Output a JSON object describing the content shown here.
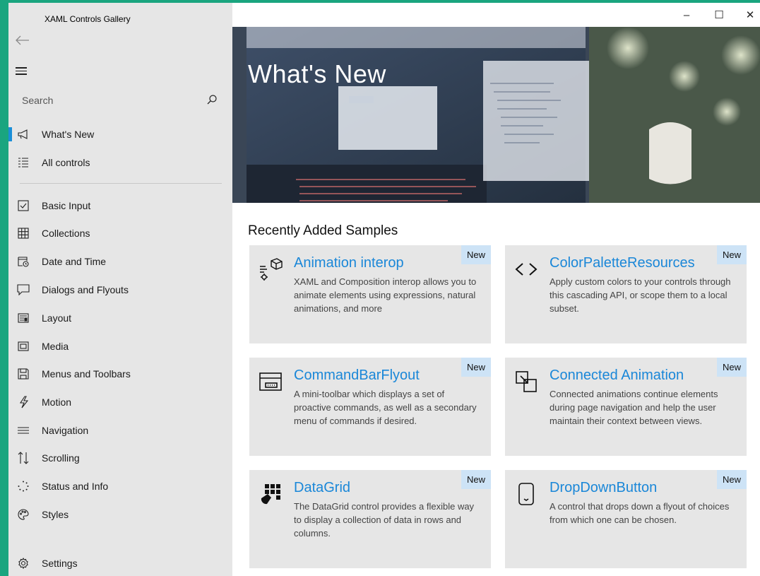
{
  "app": {
    "title": "XAML Controls Gallery"
  },
  "search": {
    "placeholder": "Search"
  },
  "nav": {
    "primary": [
      {
        "label": "What's New",
        "icon": "megaphone-icon",
        "selected": true
      },
      {
        "label": "All controls",
        "icon": "list-icon"
      }
    ],
    "categories": [
      {
        "label": "Basic Input",
        "icon": "checkbox-icon"
      },
      {
        "label": "Collections",
        "icon": "grid-icon"
      },
      {
        "label": "Date and Time",
        "icon": "calendar-clock-icon"
      },
      {
        "label": "Dialogs and Flyouts",
        "icon": "speech-bubble-icon"
      },
      {
        "label": "Layout",
        "icon": "layout-icon"
      },
      {
        "label": "Media",
        "icon": "media-icon"
      },
      {
        "label": "Menus and Toolbars",
        "icon": "save-disk-icon"
      },
      {
        "label": "Motion",
        "icon": "lightning-icon"
      },
      {
        "label": "Navigation",
        "icon": "navigation-lines-icon"
      },
      {
        "label": "Scrolling",
        "icon": "scroll-arrows-icon"
      },
      {
        "label": "Status and Info",
        "icon": "progress-ring-icon"
      },
      {
        "label": "Styles",
        "icon": "palette-icon"
      }
    ],
    "settings": {
      "label": "Settings",
      "icon": "gear-icon"
    }
  },
  "window_controls": {
    "minimize": "–",
    "maximize": "☐",
    "close": "✕"
  },
  "hero": {
    "title": "What's New"
  },
  "recent": {
    "heading": "Recently Added Samples",
    "badge": "New",
    "cards": [
      {
        "title": "Animation interop",
        "icon": "animation-interop-icon",
        "description": "XAML and Composition interop allows you to animate elements using expressions, natural animations, and more"
      },
      {
        "title": "ColorPaletteResources",
        "icon": "code-brackets-icon",
        "description": "Apply custom colors to your controls through this cascading API, or scope them to a local subset."
      },
      {
        "title": "CommandBarFlyout",
        "icon": "command-bar-icon",
        "description": "A mini-toolbar which displays a set of proactive commands, as well as a secondary menu of commands if desired."
      },
      {
        "title": "Connected Animation",
        "icon": "connected-animation-icon",
        "description": "Connected animations continue elements during page navigation and help the user maintain their context between views."
      },
      {
        "title": "DataGrid",
        "icon": "datagrid-icon",
        "description": "The DataGrid control provides a flexible way to display a collection of data in rows and columns."
      },
      {
        "title": "DropDownButton",
        "icon": "dropdown-button-icon",
        "description": "A control that drops down a flyout of choices from which one can be chosen."
      }
    ]
  },
  "colors": {
    "accent": "#1a87d8",
    "selection_bar": "#1a8fd8",
    "badge": "#cde3f6",
    "background": "#1aa57f"
  }
}
